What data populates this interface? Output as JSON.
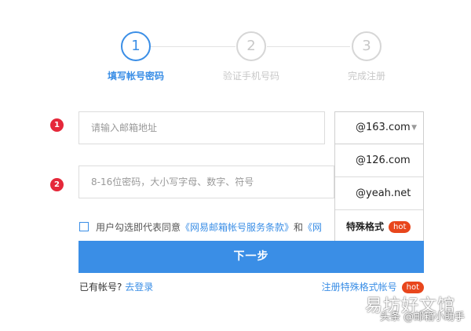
{
  "steps": [
    {
      "num": "1",
      "label": "填写帐号密码",
      "active": true
    },
    {
      "num": "2",
      "label": "验证手机号码",
      "active": false
    },
    {
      "num": "3",
      "label": "完成注册",
      "active": false
    }
  ],
  "markers": [
    "1",
    "2"
  ],
  "email": {
    "placeholder": "请输入邮箱地址"
  },
  "password": {
    "placeholder": "8-16位密码，大小写字母、数字、符号"
  },
  "domain_select": {
    "selected": "@163.com",
    "options": [
      "@126.com",
      "@yeah.net",
      "特殊格式"
    ],
    "hot_label": "hot"
  },
  "agreement": {
    "prefix": "用户勾选即代表同意",
    "link1": "《网易邮箱帐号服务条款》",
    "and": "和",
    "link2": "《网"
  },
  "next_button": "下一步",
  "login": {
    "text": "已有帐号?",
    "link": "去登录"
  },
  "special_register": {
    "label": "注册特殊格式帐号",
    "hot": "hot"
  },
  "watermark": {
    "main": "易坊好文馆",
    "sub": "头条 @邮箱小助手"
  },
  "colors": {
    "accent": "#3a8ee6",
    "marker": "#e5283a",
    "hot": "#e8461c"
  }
}
